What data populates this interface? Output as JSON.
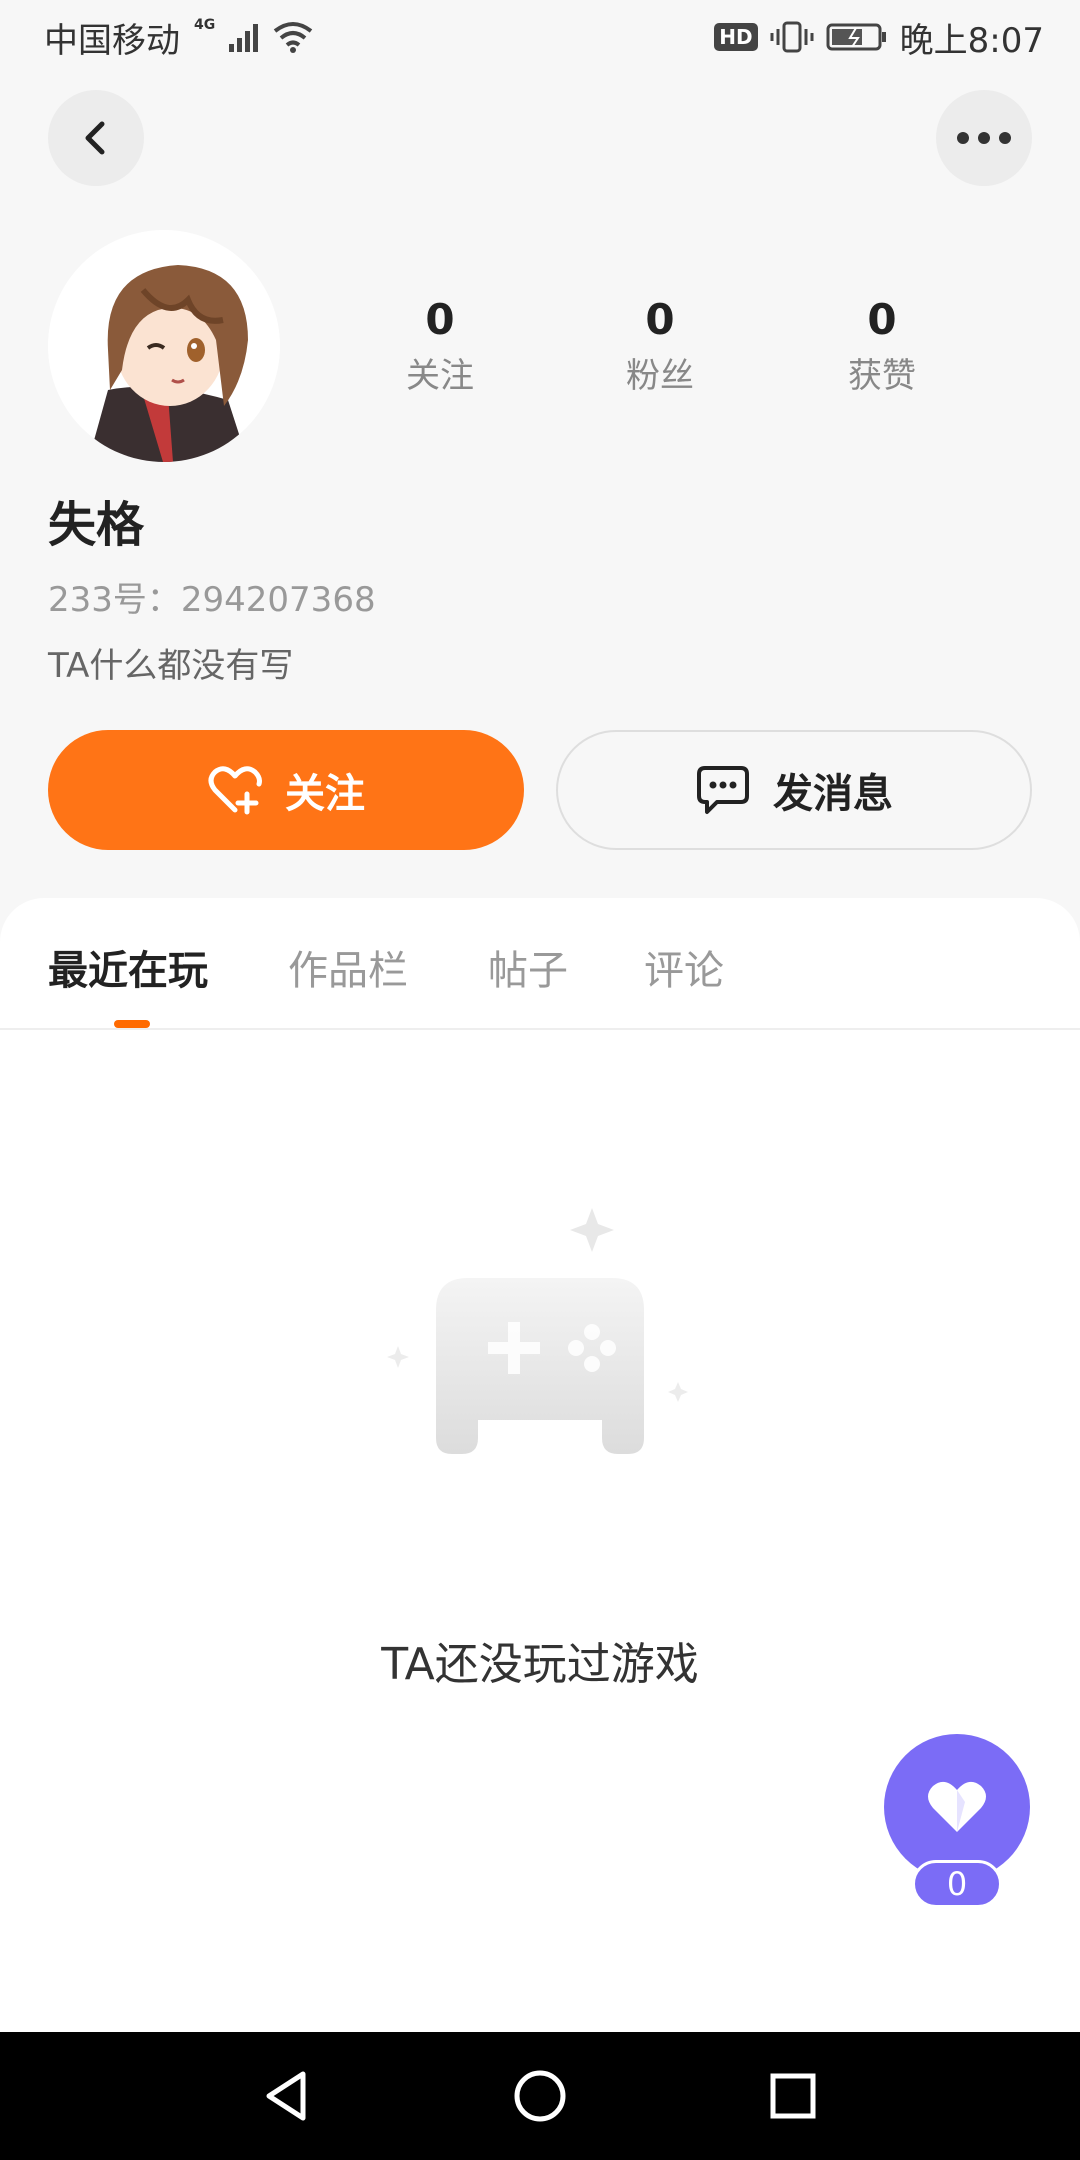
{
  "status_bar": {
    "carrier": "中国移动",
    "network": "4G",
    "hd": "HD",
    "time": "晚上8:07"
  },
  "profile": {
    "stats": [
      {
        "value": "0",
        "label": "关注"
      },
      {
        "value": "0",
        "label": "粉丝"
      },
      {
        "value": "0",
        "label": "获赞"
      }
    ],
    "name": "失格",
    "id_text": "233号：294207368",
    "bio": "TA什么都没有写"
  },
  "actions": {
    "follow_label": "关注",
    "message_label": "发消息"
  },
  "tabs": [
    {
      "label": "最近在玩",
      "active": true
    },
    {
      "label": "作品栏",
      "active": false
    },
    {
      "label": "帖子",
      "active": false
    },
    {
      "label": "评论",
      "active": false
    }
  ],
  "empty_state": {
    "text": "TA还没玩过游戏"
  },
  "like_fab": {
    "count": "0"
  },
  "colors": {
    "accent": "#ff7416",
    "like": "#7b6cf6"
  }
}
